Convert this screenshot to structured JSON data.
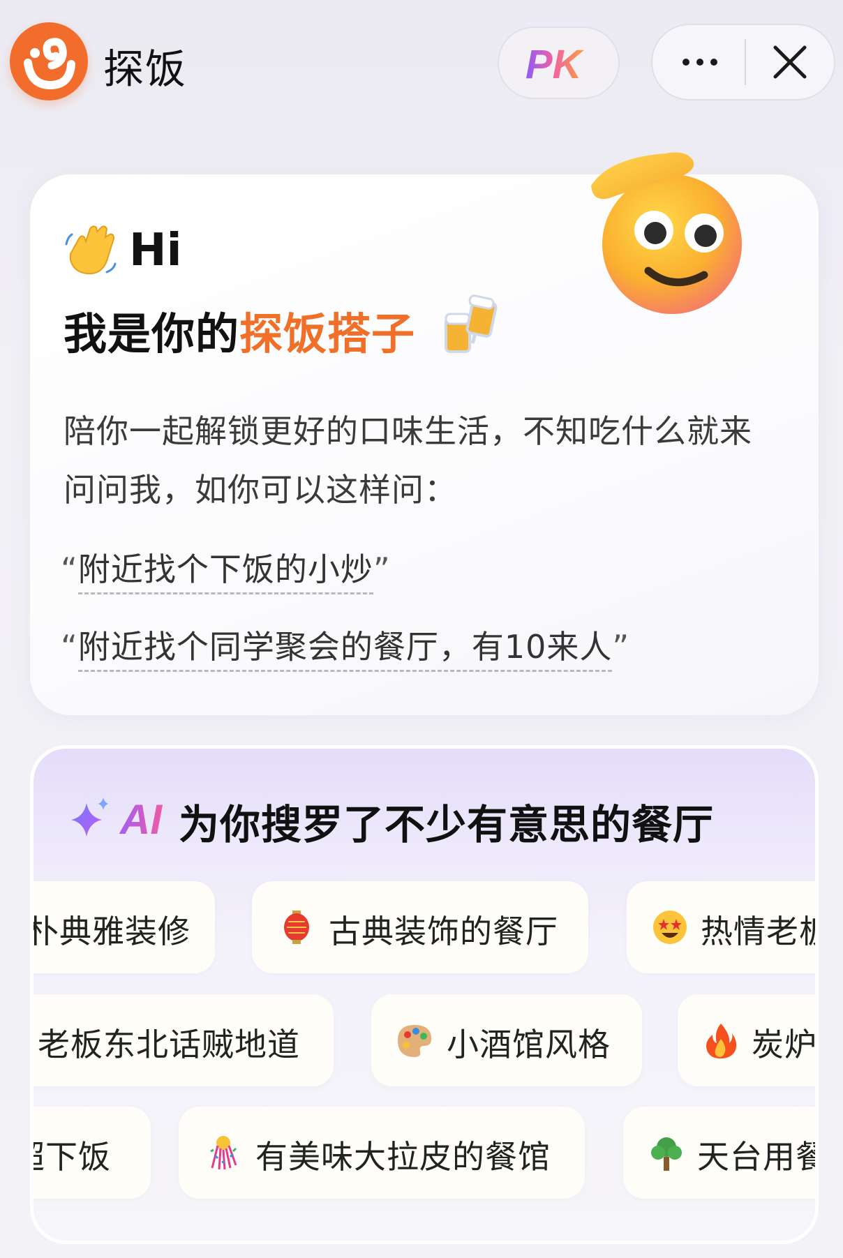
{
  "app": {
    "name": "探饭",
    "pk_label": "PK",
    "logo_color": "#f26d2c"
  },
  "greeting": {
    "hi": "Hi",
    "headline_prefix": "我是你的",
    "headline_accent": "探饭搭子",
    "intro": "陪你一起解锁更好的口味生活，不知吃什么就来问问我，如你可以这样问：",
    "examples": [
      "附近找个下饭的小炒",
      "附近找个同学聚会的餐厅，有10来人"
    ],
    "open_quote": "“",
    "close_quote": "”",
    "accent_color": "#f0702a"
  },
  "ai_section": {
    "badge": "AI",
    "title": "为你搜罗了不少有意思的餐厅",
    "rows": [
      [
        {
          "icon": "none",
          "label": "朴典雅装修"
        },
        {
          "icon": "red-lantern-icon",
          "label": "古典装饰的餐厅"
        },
        {
          "icon": "star-struck-face-icon",
          "label": "热情老板"
        }
      ],
      [
        {
          "icon": "none",
          "label": "老板东北话贼地道"
        },
        {
          "icon": "artist-palette-icon",
          "label": "小酒馆风格"
        },
        {
          "icon": "fire-icon",
          "label": "炭炉"
        }
      ],
      [
        {
          "icon": "none",
          "label": "超下饭"
        },
        {
          "icon": "confetti-ball-icon",
          "label": "有美味大拉皮的餐馆"
        },
        {
          "icon": "tree-icon",
          "label": "天台用餐"
        }
      ]
    ]
  }
}
